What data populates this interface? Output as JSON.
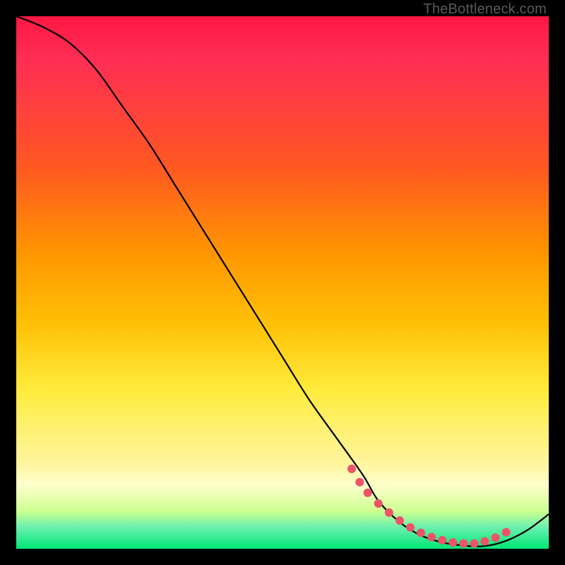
{
  "watermark": "TheBottleneck.com",
  "chart_data": {
    "type": "line",
    "title": "",
    "xlabel": "",
    "ylabel": "",
    "xlim": [
      0,
      100
    ],
    "ylim": [
      0,
      100
    ],
    "series": [
      {
        "name": "curve",
        "x": [
          0,
          5,
          10,
          15,
          20,
          25,
          30,
          35,
          40,
          45,
          50,
          55,
          60,
          65,
          68,
          72,
          76,
          80,
          84,
          88,
          92,
          96,
          100
        ],
        "y": [
          100,
          98,
          95,
          90,
          83,
          76,
          68,
          60,
          52,
          44,
          36,
          28,
          21,
          14,
          9,
          5,
          2.5,
          1.2,
          0.6,
          0.5,
          1.5,
          3.5,
          6.5
        ]
      }
    ],
    "markers": {
      "name": "dots",
      "x": [
        63,
        64.5,
        66,
        68,
        70,
        72,
        74,
        76,
        78,
        80,
        82,
        84,
        86,
        88,
        90,
        92
      ],
      "y": [
        15,
        12.5,
        10.5,
        8.5,
        6.8,
        5.3,
        4.0,
        3.0,
        2.2,
        1.6,
        1.2,
        1.0,
        1.0,
        1.4,
        2.1,
        3.1
      ]
    },
    "gradient_stops": [
      {
        "pos": 0.0,
        "color": "#ff1744"
      },
      {
        "pos": 0.28,
        "color": "#ff5722"
      },
      {
        "pos": 0.58,
        "color": "#ffc107"
      },
      {
        "pos": 0.78,
        "color": "#fff176"
      },
      {
        "pos": 0.93,
        "color": "#ccff90"
      },
      {
        "pos": 1.0,
        "color": "#00e676"
      }
    ]
  }
}
